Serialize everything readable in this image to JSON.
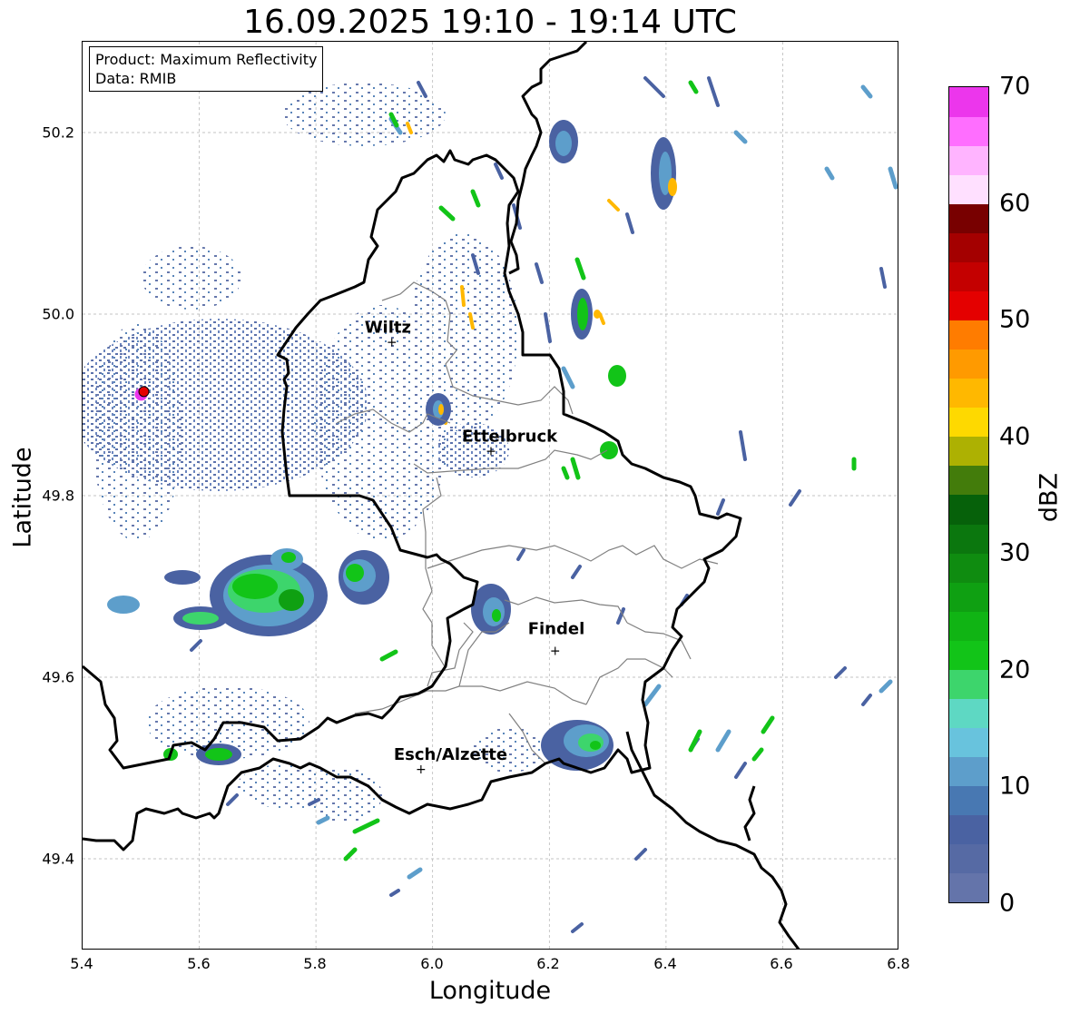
{
  "title": "16.09.2025 19:10 - 19:14 UTC",
  "info": {
    "product": "Product: Maximum Reflectivity",
    "source": "Data: RMIB"
  },
  "axes": {
    "xlabel": "Longitude",
    "ylabel": "Latitude",
    "xlim": [
      5.4,
      6.8
    ],
    "ylim": [
      49.3,
      50.3
    ],
    "xticks": [
      "5.4",
      "5.6",
      "5.8",
      "6.0",
      "6.2",
      "6.4",
      "6.6",
      "6.8"
    ],
    "yticks": [
      "49.4",
      "49.6",
      "49.8",
      "50.0",
      "50.2"
    ]
  },
  "colorbar": {
    "label": "dBZ",
    "ticks": [
      "0",
      "10",
      "20",
      "30",
      "40",
      "50",
      "60",
      "70"
    ],
    "colors": [
      "#6474aa",
      "#566aa4",
      "#4a62a2",
      "#4878b2",
      "#5d9ecb",
      "#68c3dd",
      "#5ed8c3",
      "#3dd56c",
      "#12c418",
      "#10b414",
      "#0fa012",
      "#0f8c10",
      "#0b770e",
      "#06610a",
      "#437c0b",
      "#adb102",
      "#fed900",
      "#ffb800",
      "#ff9a00",
      "#ff7c00",
      "#e40000",
      "#c40000",
      "#a40000",
      "#780000",
      "#ffe0ff",
      "#ffb4ff",
      "#ff6eff",
      "#ec36ec"
    ]
  },
  "cities": [
    {
      "name": "Wiltz",
      "lon": 5.93,
      "lat": 49.97
    },
    {
      "name": "Ettelbruck",
      "lon": 6.1,
      "lat": 49.85
    },
    {
      "name": "Findel",
      "lon": 6.21,
      "lat": 49.63
    },
    {
      "name": "Esch/Alzette",
      "lon": 5.98,
      "lat": 49.5
    }
  ],
  "radar_site": {
    "lon": 5.505,
    "lat": 49.915
  }
}
